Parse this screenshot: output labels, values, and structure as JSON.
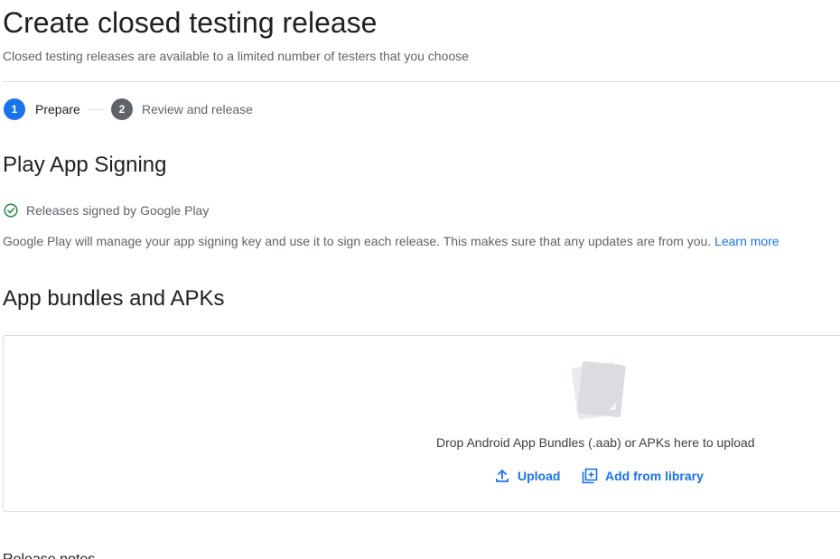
{
  "header": {
    "title": "Create closed testing release",
    "subtitle": "Closed testing releases are available to a limited number of testers that you choose"
  },
  "stepper": {
    "steps": [
      {
        "number": "1",
        "label": "Prepare",
        "state": "active"
      },
      {
        "number": "2",
        "label": "Review and release",
        "state": "inactive"
      }
    ]
  },
  "signing": {
    "heading": "Play App Signing",
    "status_label": "Releases signed by Google Play",
    "status_icon": "check-circle-icon",
    "description": "Google Play will manage your app signing key and use it to sign each release. This makes sure that any updates are from you.",
    "learn_more": "Learn more"
  },
  "bundles": {
    "heading": "App bundles and APKs",
    "drop_text": "Drop Android App Bundles (.aab) or APKs here to upload",
    "upload_label": "Upload",
    "upload_icon": "upload-icon",
    "library_label": "Add from library",
    "library_icon": "library-add-icon"
  },
  "next_section": {
    "heading": "Release notes"
  },
  "colors": {
    "accent": "#1a73e8",
    "success": "#1e8e3e",
    "text_primary": "#202124",
    "text_secondary": "#5f6368",
    "border": "#dadce0"
  }
}
